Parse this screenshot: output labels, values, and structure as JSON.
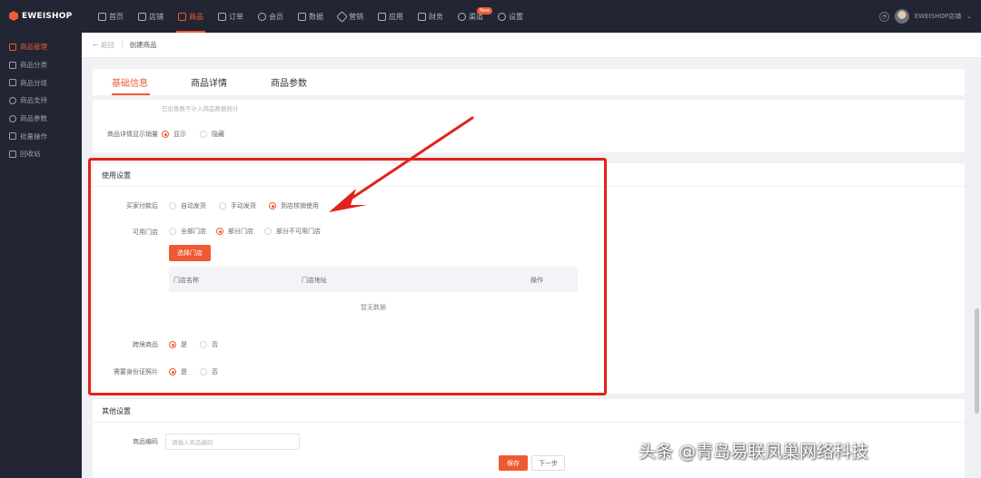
{
  "app": {
    "brand": "EWEISHOP"
  },
  "nav": {
    "items": [
      {
        "label": "首页",
        "icon": "home-icon",
        "active": false
      },
      {
        "label": "店铺",
        "icon": "store-icon",
        "active": false
      },
      {
        "label": "商品",
        "icon": "goods-icon",
        "active": true
      },
      {
        "label": "订单",
        "icon": "order-icon",
        "active": false
      },
      {
        "label": "会员",
        "icon": "member-icon",
        "active": false
      },
      {
        "label": "数据",
        "icon": "data-icon",
        "active": false
      },
      {
        "label": "营销",
        "icon": "tag-icon",
        "active": false
      },
      {
        "label": "应用",
        "icon": "app-icon",
        "active": false
      },
      {
        "label": "财务",
        "icon": "finance-icon",
        "active": false
      },
      {
        "label": "渠道",
        "icon": "channel-icon",
        "active": false,
        "badge": "New"
      },
      {
        "label": "设置",
        "icon": "gear-icon",
        "active": false
      }
    ],
    "user_name": "EWEISHOP店铺"
  },
  "sidebar": {
    "items": [
      {
        "label": "商品管理",
        "active": true
      },
      {
        "label": "商品分类",
        "active": false
      },
      {
        "label": "商品分组",
        "active": false
      },
      {
        "label": "商品支持",
        "active": false
      },
      {
        "label": "商品参数",
        "active": false
      },
      {
        "label": "批量操作",
        "active": false
      },
      {
        "label": "回收站",
        "active": false
      }
    ]
  },
  "breadcrumb": {
    "back": "← 返回",
    "current": "创建商品"
  },
  "tabs": [
    {
      "label": "基础信息",
      "active": true
    },
    {
      "label": "商品详情",
      "active": false
    },
    {
      "label": "商品参数",
      "active": false
    }
  ],
  "sales_panel": {
    "hint": "已出售数不计入商品数据统计",
    "label": "商品详情显示销量",
    "options": [
      {
        "label": "显示",
        "checked": true
      },
      {
        "label": "隐藏",
        "checked": false
      }
    ]
  },
  "usage": {
    "title": "使用设置",
    "after_pay": {
      "label": "买家付款后",
      "options": [
        {
          "label": "自动发货",
          "checked": false
        },
        {
          "label": "手动发货",
          "checked": false
        },
        {
          "label": "到店核销使用",
          "checked": true
        }
      ]
    },
    "stores": {
      "label": "可用门店",
      "options": [
        {
          "label": "全部门店",
          "checked": false
        },
        {
          "label": "部分门店",
          "checked": true
        },
        {
          "label": "部分不可用门店",
          "checked": false
        }
      ],
      "select_button": "选择门店",
      "columns": [
        "门店名称",
        "门店地址",
        "操作"
      ],
      "empty": "暂无数据"
    },
    "cross_border": {
      "label": "跨境商品",
      "options": [
        {
          "label": "是",
          "checked": true
        },
        {
          "label": "否",
          "checked": false
        }
      ]
    },
    "id_photo": {
      "label": "需要身份证照片",
      "options": [
        {
          "label": "是",
          "checked": true
        },
        {
          "label": "否",
          "checked": false
        }
      ]
    }
  },
  "other": {
    "title": "其他设置",
    "code_label": "商品编码",
    "code_placeholder": "请输入商品编码"
  },
  "footer": {
    "save": "保存",
    "next": "下一步"
  },
  "watermark": "头条 @青岛易联凤巢网络科技",
  "colors": {
    "accent": "#ef5a32",
    "annotation": "#e2231a",
    "topbar": "#222533"
  }
}
